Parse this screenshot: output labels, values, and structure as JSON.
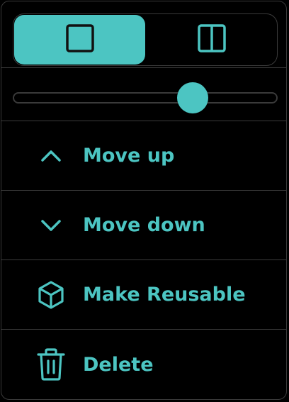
{
  "colors": {
    "accent": "#4cc5c2",
    "background": "#000000",
    "border": "#3a3a3a",
    "icon_on_accent": "#111111"
  },
  "layout_toggle": {
    "options": [
      {
        "id": "single",
        "icon": "single-pane-icon",
        "active": true
      },
      {
        "id": "split",
        "icon": "split-pane-icon",
        "active": false
      }
    ]
  },
  "slider": {
    "value_fraction": 0.68
  },
  "menu": {
    "items": [
      {
        "id": "move-up",
        "label": "Move up",
        "icon": "chevron-up-icon"
      },
      {
        "id": "move-down",
        "label": "Move down",
        "icon": "chevron-down-icon"
      },
      {
        "id": "make-reusable",
        "label": "Make Reusable",
        "icon": "cube-icon"
      },
      {
        "id": "delete",
        "label": "Delete",
        "icon": "trash-icon"
      }
    ]
  }
}
